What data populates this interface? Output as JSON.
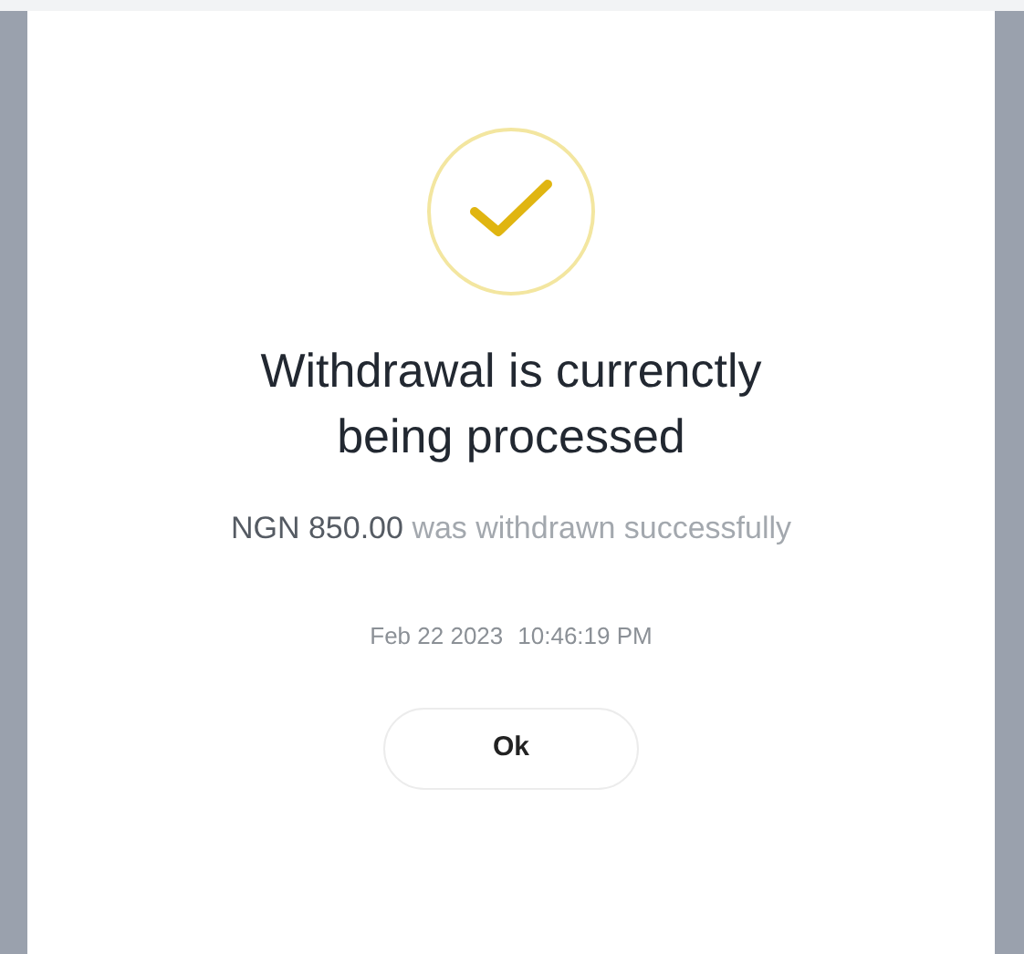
{
  "dialog": {
    "title": "Withdrawal is currenctly being processed",
    "message": {
      "amount": "NGN 850.00",
      "text": "was withdrawn successfully"
    },
    "date": "Feb 22 2023",
    "time": "10:46:19 PM",
    "buttons": [
      "Ok"
    ]
  }
}
